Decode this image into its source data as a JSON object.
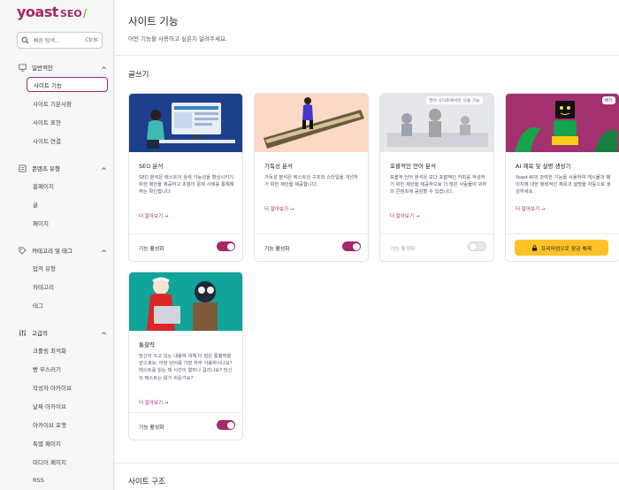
{
  "sidebar": {
    "logo": {
      "brand": "yoast",
      "product": "SEO",
      "slash": "/"
    },
    "search": {
      "placeholder": "빠른 탐색...",
      "shortcut": "CtrlK"
    },
    "groups": [
      {
        "label": "일반적인",
        "icon": "monitor-icon",
        "items": [
          "사이트 기능",
          "사이트 기본사항",
          "사이트 표현",
          "사이트 연결"
        ]
      },
      {
        "label": "콘텐츠 유형",
        "icon": "document-icon",
        "items": [
          "홈페이지",
          "글",
          "페이지"
        ]
      },
      {
        "label": "카테고리 및 태그",
        "icon": "tag-icon",
        "items": [
          "업적 유형",
          "카테고리",
          "태그"
        ]
      },
      {
        "label": "고급의",
        "icon": "sliders-icon",
        "items": [
          "크롤링 최적화",
          "빵 부스러기",
          "작성자 아카이브",
          "날짜 아카이브",
          "아카이브 포맷",
          "특별 페이지",
          "미디어 페이지",
          "RSS"
        ]
      }
    ]
  },
  "main": {
    "title": "사이트 기능",
    "subtitle": "어떤 기능을 사용하고 싶은지 알려주세요.",
    "sections": [
      {
        "title": "글쓰기"
      },
      {
        "title": "사이트 구조"
      }
    ],
    "cards": [
      {
        "title": "SEO 분석",
        "desc": "SEO 분석은 텍스트의 검색 가능성을 향상시키기 위한 제안을 제공하고 초점이 문제 사례를 통해해주는 확인합니다.",
        "link": "더 알아보기 →",
        "footer_label": "기능 활성화",
        "enabled": true
      },
      {
        "title": "가독성 분석",
        "desc": "가독성 분석은 텍스트의 구조와 스타일을 개선하기 위한 제안을 제공합니다.",
        "link": "더 알아보기 →",
        "footer_label": "기능 활성화",
        "enabled": true
      },
      {
        "title": "포괄적인 언어 분석",
        "desc": "포괄적 언어 분석은 보다 포괄적인 카피를 작성하기 위한 제안을 제공하므로 더 많은 사람들이 귀하의 콘텐츠에 공감할 수 있습니다.",
        "link": "더 알아보기 →",
        "footer_label": "기능 활성화",
        "enabled": false,
        "badge": "영어 사이트에서만 사용 가능"
      },
      {
        "title": "AI 제목 및 설명 생성기",
        "desc": "Yoast AI의 강력한 기능을 사용하여 게시물과 페이지에 대한 매력적인 제목과 설명을 자동으로 생성하세요.",
        "link": "더 알아보기 →",
        "upgrade_label": "프리미엄으로 잠금 해제",
        "badge": "베타"
      },
      {
        "title": "통찰력",
        "desc": "당신이 쓰고 있는 내용에 대해 더 많은 통찰력을 얻으세요. 어떤 단어를 가장 자주 사용하시나요? 텍스트를 읽는 데 시간이 얼마나 걸리나요? 당신의 텍스트는 읽기 쉬운가요?",
        "link": "더 알아보기 →",
        "footer_label": "기능 활성화",
        "enabled": true
      }
    ]
  },
  "colors": {
    "brand": "#a4286a",
    "accent_green": "#77b227",
    "upgrade": "#fec228"
  }
}
